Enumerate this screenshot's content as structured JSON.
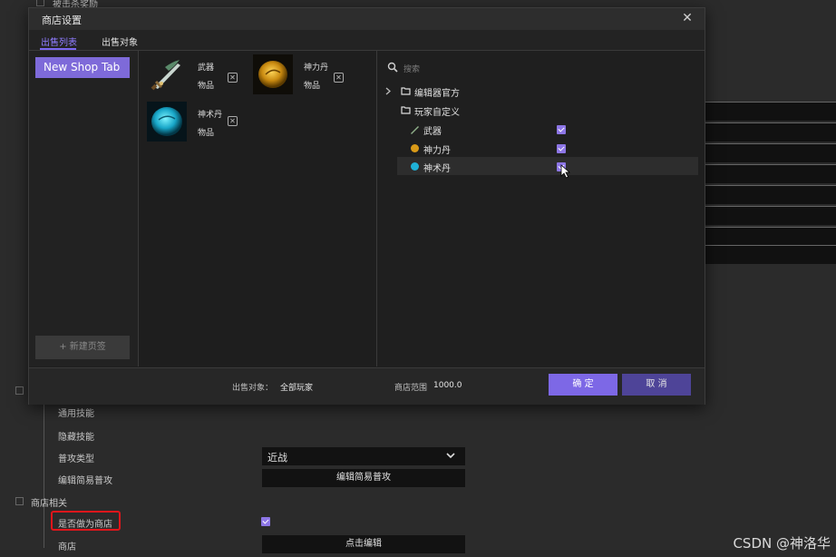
{
  "background": {
    "top_partial_label": "被击杀奖励",
    "rows": {
      "common_skills": "通用技能",
      "hidden_skills": "隐藏技能",
      "attack_type": "普攻类型",
      "edit_simple_attack": "编辑简易普攻",
      "shop_section": "商店相关",
      "is_shop": "是否做为商店",
      "shop": "商店"
    },
    "attack_type_value": "近战",
    "edit_simple_attack_button": "编辑简易普攻",
    "shop_edit_button": "点击编辑",
    "is_shop_checked": true
  },
  "watermark": "CSDN @神洛华",
  "dialog": {
    "title": "商店设置",
    "tabs": [
      {
        "label": "出售列表",
        "active": true
      },
      {
        "label": "出售对象",
        "active": false
      }
    ],
    "shop_tabs": [
      "New Shop Tab"
    ],
    "new_tab_button": "+ 新建页签",
    "items": [
      {
        "name": "武器",
        "type": "物品",
        "icon": "sword-icon"
      },
      {
        "name": "神力丹",
        "type": "物品",
        "icon": "gold-pill-icon"
      },
      {
        "name": "神术丹",
        "type": "物品",
        "icon": "blue-pill-icon"
      }
    ],
    "search_placeholder": "搜索",
    "tree": {
      "official": "编辑器官方",
      "custom": "玩家自定义",
      "children": [
        {
          "name": "武器",
          "checked": true
        },
        {
          "name": "神力丹",
          "checked": true
        },
        {
          "name": "神术丹",
          "checked": true
        }
      ]
    },
    "footer": {
      "target_label": "出售对象：",
      "target_value": "全部玩家",
      "range_label": "商店范围",
      "range_value": "1000.0",
      "ok": "确 定",
      "cancel": "取 消"
    }
  },
  "colors": {
    "accent": "#7d68e6",
    "highlight_box": "#e0161b"
  }
}
